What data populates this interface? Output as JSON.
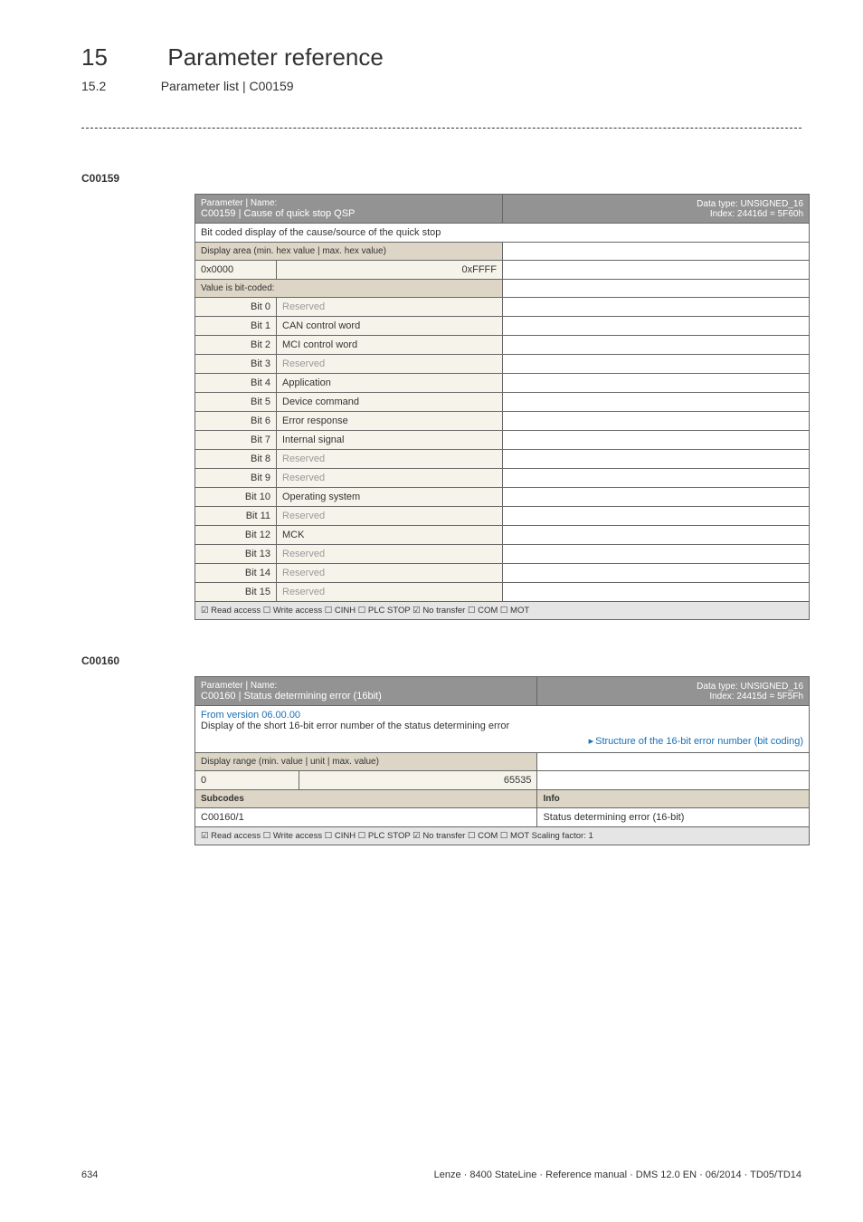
{
  "header": {
    "chapter_number": "15",
    "chapter_title": "Parameter reference",
    "subsection_number": "15.2",
    "subsection_title": "Parameter list | C00159"
  },
  "anchor1": "C00159",
  "table1": {
    "param_label": "Parameter | Name:",
    "param_name": "C00159 | Cause of quick stop QSP",
    "data_type": "Data type: UNSIGNED_16",
    "index": "Index: 24416d = 5F60h",
    "desc": "Bit coded display of the cause/source of the quick stop",
    "display_area": "Display area (min. hex value | max. hex value)",
    "hex_min": "0x0000",
    "hex_max": "0xFFFF",
    "value_coded": "Value is bit-coded:",
    "bits": [
      {
        "n": "Bit 0",
        "v": "Reserved",
        "r": true
      },
      {
        "n": "Bit 1",
        "v": "CAN control word",
        "r": false
      },
      {
        "n": "Bit 2",
        "v": "MCI control word",
        "r": false
      },
      {
        "n": "Bit 3",
        "v": "Reserved",
        "r": true
      },
      {
        "n": "Bit 4",
        "v": "Application",
        "r": false
      },
      {
        "n": "Bit 5",
        "v": "Device command",
        "r": false
      },
      {
        "n": "Bit 6",
        "v": "Error response",
        "r": false
      },
      {
        "n": "Bit 7",
        "v": "Internal signal",
        "r": false
      },
      {
        "n": "Bit 8",
        "v": "Reserved",
        "r": true
      },
      {
        "n": "Bit 9",
        "v": "Reserved",
        "r": true
      },
      {
        "n": "Bit 10",
        "v": "Operating system",
        "r": false
      },
      {
        "n": "Bit 11",
        "v": "Reserved",
        "r": true
      },
      {
        "n": "Bit 12",
        "v": "MCK",
        "r": false
      },
      {
        "n": "Bit 13",
        "v": "Reserved",
        "r": true
      },
      {
        "n": "Bit 14",
        "v": "Reserved",
        "r": true
      },
      {
        "n": "Bit 15",
        "v": "Reserved",
        "r": true
      }
    ],
    "access": "☑ Read access   ☐ Write access   ☐ CINH   ☐ PLC STOP   ☑ No transfer   ☐ COM   ☐ MOT"
  },
  "anchor2": "C00160",
  "table2": {
    "param_label": "Parameter | Name:",
    "param_name": "C00160 | Status determining error (16bit)",
    "data_type": "Data type: UNSIGNED_16",
    "index": "Index: 24415d = 5F5Fh",
    "version_link": "From version 06.00.00",
    "desc": "Display of the short 16-bit error number of the status determining error",
    "structure_link": "Structure of the 16-bit error number (bit coding)",
    "display_range": "Display range (min. value | unit | max. value)",
    "range_min": "0",
    "range_max": "65535",
    "subcodes_label": "Subcodes",
    "info_label": "Info",
    "subcode": "C00160/1",
    "subcode_info": "Status determining error (16-bit)",
    "access": "☑ Read access   ☐ Write access   ☐ CINH   ☐ PLC STOP   ☑ No transfer   ☐ COM   ☐ MOT     Scaling factor: 1"
  },
  "footer": {
    "page": "634",
    "text": "Lenze · 8400 StateLine · Reference manual · DMS 12.0 EN · 06/2014 · TD05/TD14"
  }
}
